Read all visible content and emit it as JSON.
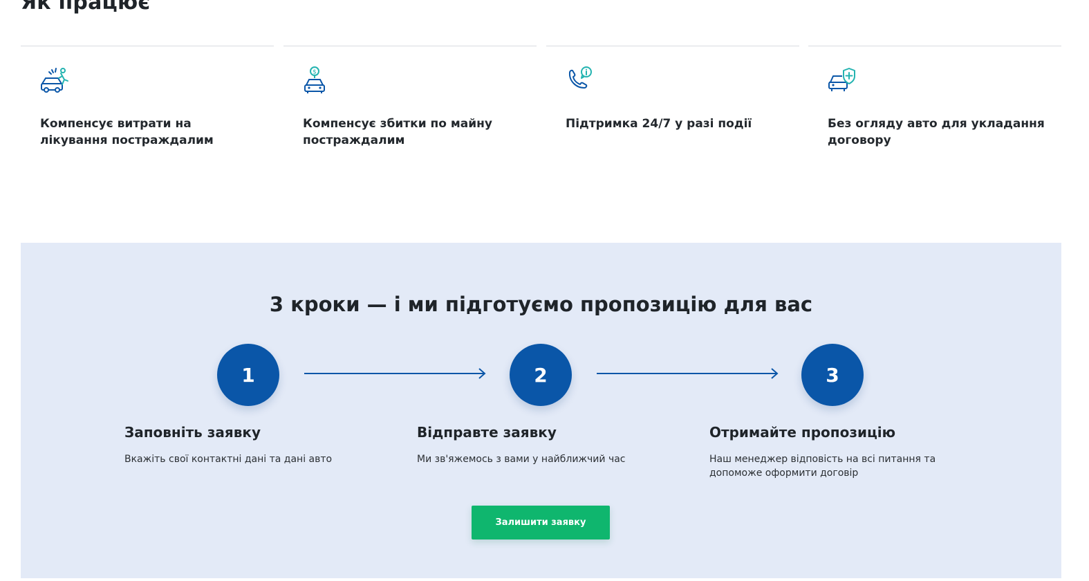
{
  "section": {
    "title": "Як працює"
  },
  "features": [
    {
      "icon": "car-injury-icon",
      "text": "Компенсує витрати на лікування постраждалим"
    },
    {
      "icon": "car-money-icon",
      "text": "Компенсує збитки по майну постраждалим"
    },
    {
      "icon": "phone-info-icon",
      "text": "Підтримка 24/7 у разі події"
    },
    {
      "icon": "car-shield-icon",
      "text": "Без огляду авто для укладання договору"
    }
  ],
  "steps_section": {
    "title": "3 кроки — і ми підготуємо пропозицію для вас",
    "steps": [
      {
        "number": "1",
        "title": "Заповніть заявку",
        "description": "Вкажіть свої контактні дані та дані авто"
      },
      {
        "number": "2",
        "title": "Відправте заявку",
        "description": "Ми зв'яжемось з вами у найближчий час"
      },
      {
        "number": "3",
        "title": "Отримайте пропозицію",
        "description": "Наш менеджер відповість на всі питання та допоможе оформити договір"
      }
    ],
    "cta_label": "Залишити заявку"
  },
  "colors": {
    "primary": "#0a56a8",
    "accent_teal": "#23b3b0",
    "cta": "#0fb66e",
    "panel_bg": "#e3eaf7"
  }
}
